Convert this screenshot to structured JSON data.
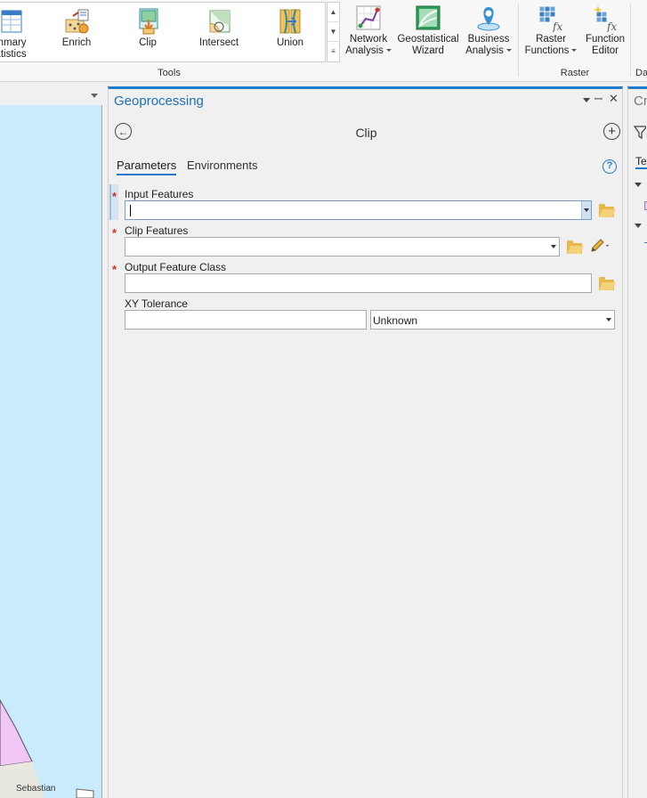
{
  "ribbon": {
    "tools": [
      {
        "label1": "mmary",
        "label2": "atistics",
        "icon": "summary-statistics-icon"
      },
      {
        "label1": "Enrich",
        "label2": "",
        "icon": "enrich-icon"
      },
      {
        "label1": "Clip",
        "label2": "",
        "icon": "clip-icon"
      },
      {
        "label1": "Intersect",
        "label2": "",
        "icon": "intersect-icon"
      },
      {
        "label1": "Union",
        "label2": "",
        "icon": "union-icon"
      }
    ],
    "tools_group_label": "Tools",
    "analysis": [
      {
        "label1": "Network",
        "label2": "Analysis",
        "icon": "network-analysis-icon"
      },
      {
        "label1": "Geostatistical",
        "label2": "Wizard",
        "icon": "geostatistical-wizard-icon"
      },
      {
        "label1": "Business",
        "label2": "Analysis",
        "icon": "business-analysis-icon"
      }
    ],
    "raster": [
      {
        "label1": "Raster",
        "label2": "Functions",
        "icon": "raster-functions-icon"
      },
      {
        "label1": "Function",
        "label2": "Editor",
        "icon": "function-editor-icon"
      }
    ],
    "raster_group_label": "Raster",
    "cut_group_label": "Da"
  },
  "map": {
    "place_label": "Sebastian"
  },
  "geoprocessing": {
    "pane_title": "Geoprocessing",
    "tool_title": "Clip",
    "tabs": [
      {
        "label": "Parameters",
        "active": true
      },
      {
        "label": "Environments",
        "active": false
      }
    ],
    "help_glyph": "?",
    "fields": {
      "input_features": {
        "label": "Input Features",
        "value": "",
        "required": true
      },
      "clip_features": {
        "label": "Clip Features",
        "value": "",
        "required": true
      },
      "output_feature_class": {
        "label": "Output Feature Class",
        "value": "",
        "required": true
      },
      "xy_tolerance": {
        "label": "XY Tolerance",
        "value": "",
        "unit": "Unknown",
        "required": false
      }
    },
    "required_marker": "*"
  },
  "right_pane": {
    "title_cut": "Cr",
    "tab_cut": "Te"
  }
}
